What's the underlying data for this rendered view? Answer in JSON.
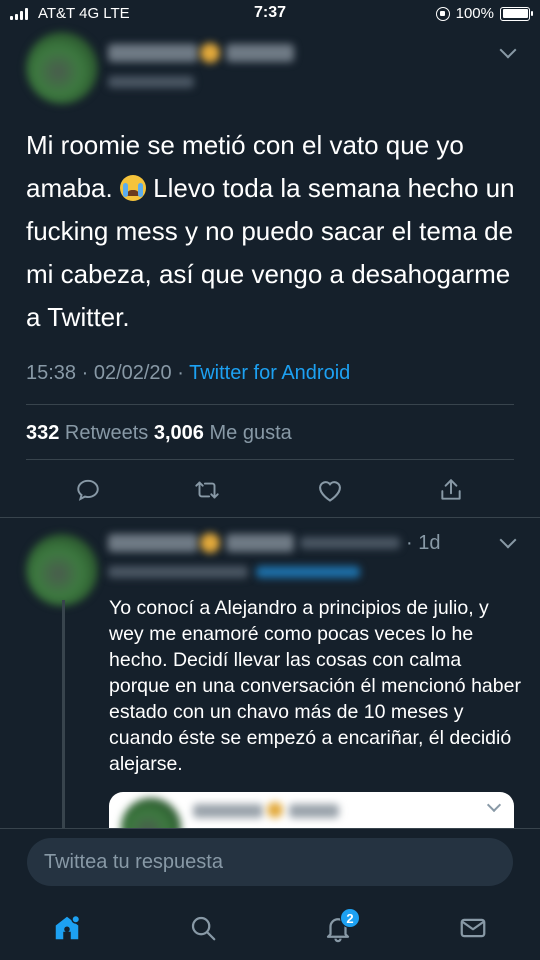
{
  "status_bar": {
    "carrier": "AT&T 4G  LTE",
    "time": "7:37",
    "battery_text": "100%",
    "battery_level": 1.0
  },
  "tweet": {
    "text_before_emoji": "Mi roomie se metió con el vato que yo amaba. ",
    "emoji": "loudly-crying-face",
    "text_after_emoji": " Llevo toda la semana hecho un fucking mess y no puedo sacar el tema de mi cabeza, así que vengo a desahogarme a Twitter.",
    "timestamp": "15:38 · 02/02/20 · ",
    "source": "Twitter for Android",
    "retweets_count": "332",
    "retweets_label": " Retweets ",
    "likes_count": "3,006",
    "likes_label": " Me gusta"
  },
  "reply": {
    "time": "· 1d",
    "text": "Yo conocí a Alejandro a principios de julio, y wey me enamoré como pocas veces lo he hecho. Decidí llevar las cosas con calma porque en una conversación él mencionó haber estado con un chavo más de 10 meses y cuando éste se empezó a encariñar, él decidió alejarse."
  },
  "compose": {
    "placeholder": "Twittea tu respuesta"
  },
  "tabbar": {
    "notifications_badge": "2"
  },
  "colors": {
    "background": "#15202b",
    "accent": "#1da1f2",
    "secondary_text": "#8899a6",
    "divider": "#38444d"
  }
}
